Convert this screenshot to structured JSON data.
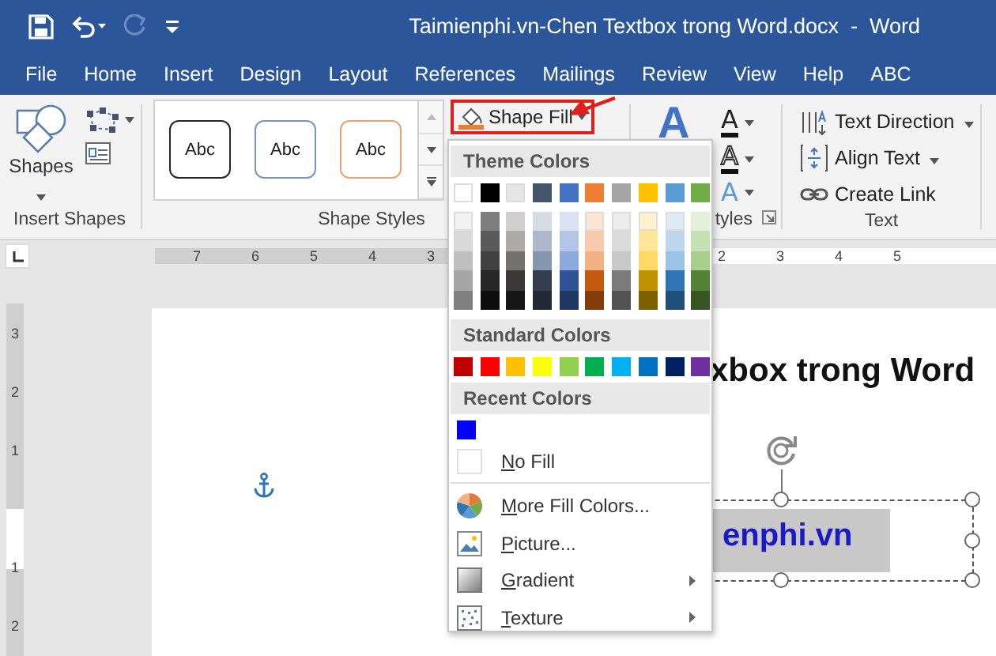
{
  "quick_access": [
    {
      "kind": "save",
      "disabled": false
    },
    {
      "kind": "undo",
      "disabled": false
    },
    {
      "kind": "redo",
      "disabled": true
    },
    {
      "kind": "customize",
      "disabled": false
    }
  ],
  "window": {
    "title": "Taimienphi.vn-Chen Textbox trong Word.docx  -  Word"
  },
  "tabs": [
    {
      "label": "File",
      "selected": false
    },
    {
      "label": "Home",
      "selected": false
    },
    {
      "label": "Insert",
      "selected": false
    },
    {
      "label": "Design",
      "selected": false
    },
    {
      "label": "Layout",
      "selected": false
    },
    {
      "label": "References",
      "selected": false
    },
    {
      "label": "Mailings",
      "selected": false
    },
    {
      "label": "Review",
      "selected": false
    },
    {
      "label": "View",
      "selected": false
    },
    {
      "label": "Help",
      "selected": false
    },
    {
      "label": "ABC",
      "selected": false
    }
  ],
  "ribbon": {
    "insert_shapes": {
      "label": "Insert Shapes",
      "shapes_button": "Shapes"
    },
    "shape_styles": {
      "label": "Shape Styles",
      "styles": [
        {
          "text": "Abc",
          "color": "#262626"
        },
        {
          "text": "Abc",
          "color": "#7a95c4"
        },
        {
          "text": "Abc",
          "color": "#e9a274"
        }
      ]
    },
    "shape_fill": {
      "label": "Shape Fill",
      "highlighted": true
    },
    "wordart_styles": {
      "label": "tyles",
      "big_glyph": "A",
      "small_glyphs": [
        "A",
        "A",
        "A"
      ]
    },
    "text": {
      "label": "Text",
      "buttons": [
        {
          "label": "Text Direction",
          "kind": "direction",
          "dropdown": true
        },
        {
          "label": "Align Text",
          "kind": "align",
          "dropdown": true
        },
        {
          "label": "Create Link",
          "kind": "link",
          "dropdown": false
        }
      ]
    }
  },
  "ruler": {
    "left_numbers": [
      "7",
      "6",
      "5",
      "4",
      "3"
    ],
    "right_numbers": [
      "2",
      "3",
      "4",
      "5"
    ],
    "vertical_numbers_upper": [
      "3",
      "2",
      "1"
    ],
    "vertical_numbers_lower": [
      "1",
      "2"
    ]
  },
  "document": {
    "heading": "xbox trong Word",
    "textbox_text": "enphi.vn"
  },
  "shape_fill_menu": {
    "theme_header": "Theme Colors",
    "theme_colors": [
      {
        "color": "#ffffff",
        "shades": [
          {
            "color": "#f2f2f2"
          },
          {
            "color": "#d9d9d9"
          },
          {
            "color": "#bfbfbf"
          },
          {
            "color": "#a6a6a6"
          },
          {
            "color": "#808080"
          }
        ]
      },
      {
        "color": "#000000",
        "shades": [
          {
            "color": "#7f7f7f"
          },
          {
            "color": "#595959"
          },
          {
            "color": "#404040"
          },
          {
            "color": "#262626"
          },
          {
            "color": "#0d0d0d"
          }
        ]
      },
      {
        "color": "#e7e6e6",
        "shades": [
          {
            "color": "#d0cece"
          },
          {
            "color": "#aeaaaa"
          },
          {
            "color": "#757171"
          },
          {
            "color": "#3a3838"
          },
          {
            "color": "#171616"
          }
        ]
      },
      {
        "color": "#44546a",
        "shades": [
          {
            "color": "#d6dce4"
          },
          {
            "color": "#adb9ca"
          },
          {
            "color": "#8496b0"
          },
          {
            "color": "#333f4f"
          },
          {
            "color": "#222a35"
          }
        ]
      },
      {
        "color": "#4472c4",
        "shades": [
          {
            "color": "#d9e2f3"
          },
          {
            "color": "#b4c6e7"
          },
          {
            "color": "#8eaadb"
          },
          {
            "color": "#2f5496"
          },
          {
            "color": "#1f3864"
          }
        ]
      },
      {
        "color": "#ed7d31",
        "shades": [
          {
            "color": "#fbe5d5"
          },
          {
            "color": "#f7cbac"
          },
          {
            "color": "#f4b183"
          },
          {
            "color": "#c55a11"
          },
          {
            "color": "#843c0b"
          }
        ]
      },
      {
        "color": "#a5a5a5",
        "shades": [
          {
            "color": "#ededed"
          },
          {
            "color": "#dbdbdb"
          },
          {
            "color": "#c9c9c9"
          },
          {
            "color": "#7b7b7b"
          },
          {
            "color": "#525252"
          }
        ]
      },
      {
        "color": "#ffc000",
        "shades": [
          {
            "color": "#fff2cc"
          },
          {
            "color": "#fee599"
          },
          {
            "color": "#ffd966"
          },
          {
            "color": "#bf9000"
          },
          {
            "color": "#7f6000"
          }
        ]
      },
      {
        "color": "#5b9bd5",
        "shades": [
          {
            "color": "#deebf6"
          },
          {
            "color": "#bdd7ee"
          },
          {
            "color": "#9dc3e6"
          },
          {
            "color": "#2e75b5"
          },
          {
            "color": "#1f4e79"
          }
        ]
      },
      {
        "color": "#70ad47",
        "shades": [
          {
            "color": "#e2efd9"
          },
          {
            "color": "#c5e0b3"
          },
          {
            "color": "#a8d08d"
          },
          {
            "color": "#538135"
          },
          {
            "color": "#375623"
          }
        ]
      }
    ],
    "standard_header": "Standard Colors",
    "standard_colors": [
      {
        "color": "#c00000"
      },
      {
        "color": "#ff0000"
      },
      {
        "color": "#ffc000"
      },
      {
        "color": "#ffff00"
      },
      {
        "color": "#92d050"
      },
      {
        "color": "#00b050"
      },
      {
        "color": "#00b0f0"
      },
      {
        "color": "#0070c0"
      },
      {
        "color": "#002060"
      },
      {
        "color": "#7030a0"
      }
    ],
    "recent_header": "Recent Colors",
    "recent_colors": [
      {
        "color": "#0000ff"
      }
    ],
    "items": [
      {
        "kind": "no_fill",
        "label": "No Fill",
        "underline_first": true,
        "submenu": false
      },
      {
        "kind": "palette",
        "label": "More Fill Colors...",
        "underline_first": true,
        "submenu": false
      },
      {
        "kind": "picture",
        "label": "Picture...",
        "underline_first": true,
        "submenu": false
      },
      {
        "kind": "gradient",
        "label": "Gradient",
        "underline_first": true,
        "submenu": true
      },
      {
        "kind": "texture",
        "label": "Texture",
        "underline_first": true,
        "submenu": true
      }
    ]
  }
}
